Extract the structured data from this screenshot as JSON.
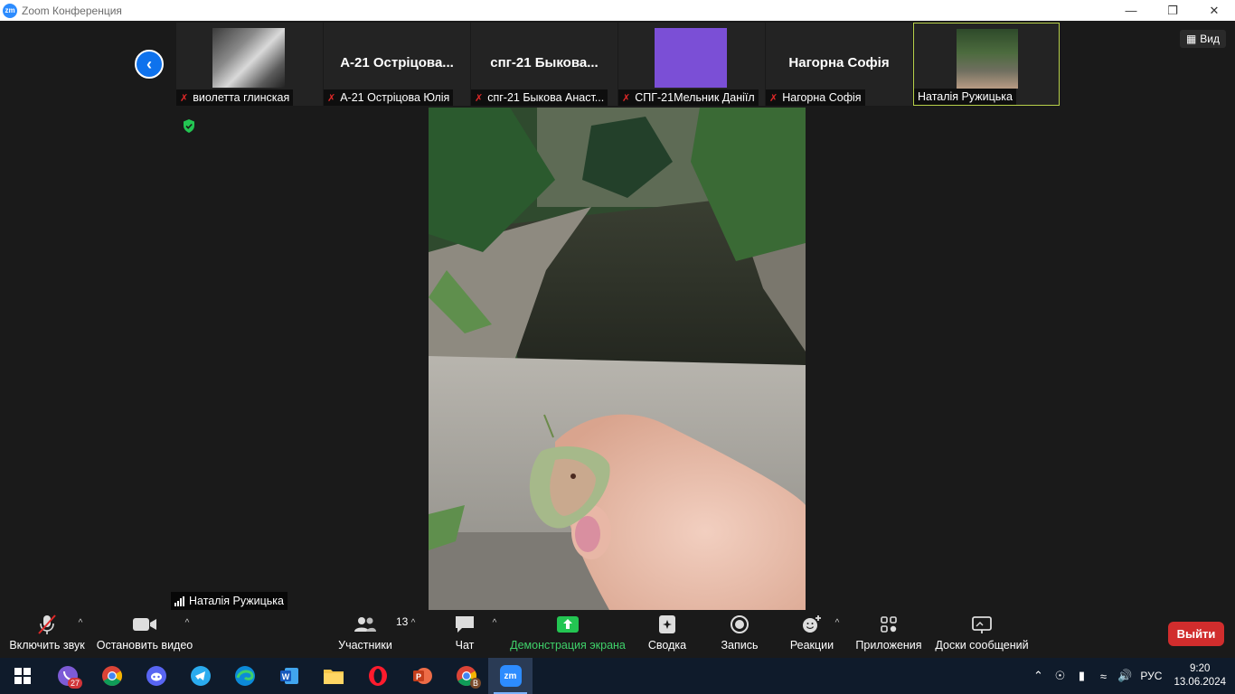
{
  "window": {
    "title": "Zoom Конференция",
    "logo": "zm"
  },
  "header": {
    "view_label": "Вид"
  },
  "participants_strip": [
    {
      "label": "виолетта глинская",
      "big_name": "",
      "muted": true,
      "has_video": true
    },
    {
      "label": "А-21 Остріцова Юлія",
      "big_name": "А-21 Остріцова...",
      "muted": true,
      "has_video": false
    },
    {
      "label": "спг-21 Быкова Анаст...",
      "big_name": "спг-21  Быкова...",
      "muted": true,
      "has_video": false
    },
    {
      "label": "СПГ-21Мельник Даніїл",
      "big_name": "",
      "muted": true,
      "has_video": true
    },
    {
      "label": "Нагорна Софія",
      "big_name": "Нагорна Софія",
      "muted": true,
      "has_video": false
    },
    {
      "label": "Наталія Ружицька",
      "big_name": "",
      "muted": false,
      "has_video": true,
      "active": true
    }
  ],
  "main_video": {
    "speaker_name": "Наталія Ружицька"
  },
  "toolbar": {
    "unmute": "Включить звук",
    "stop_video": "Остановить видео",
    "participants": "Участники",
    "participants_count": "13",
    "chat": "Чат",
    "share_screen": "Демонстрация экрана",
    "summary": "Сводка",
    "record": "Запись",
    "reactions": "Реакции",
    "apps": "Приложения",
    "whiteboards": "Доски сообщений",
    "leave": "Выйти"
  },
  "taskbar": {
    "viber_badge": "27",
    "chrome_profile_badge": "В",
    "zoom_label": "zm",
    "language": "РУС",
    "time": "9:20",
    "date": "13.06.2024"
  },
  "colors": {
    "accent": "#0e72ed",
    "share_green": "#3fd16a",
    "leave_red": "#d12d2d",
    "active_border": "#b7d04a"
  }
}
